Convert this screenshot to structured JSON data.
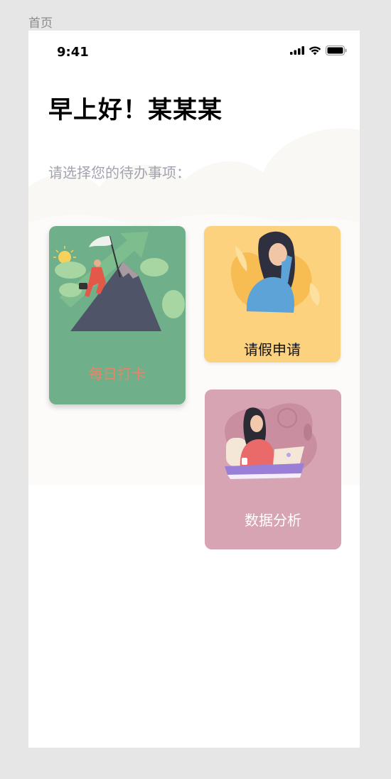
{
  "page": {
    "label": "首页"
  },
  "status_bar": {
    "time": "9:41"
  },
  "greeting": "早上好！某某某",
  "prompt": "请选择您的待办事项：",
  "cards": [
    {
      "title": "每日打卡",
      "color": "#6fb08a",
      "icon": "mountain-climber-illustration"
    },
    {
      "title": "请假申请",
      "color": "#fdd27f",
      "icon": "tired-woman-illustration"
    },
    {
      "title": "数据分析",
      "color": "#d7a4b3",
      "icon": "woman-laptop-illustration"
    }
  ]
}
